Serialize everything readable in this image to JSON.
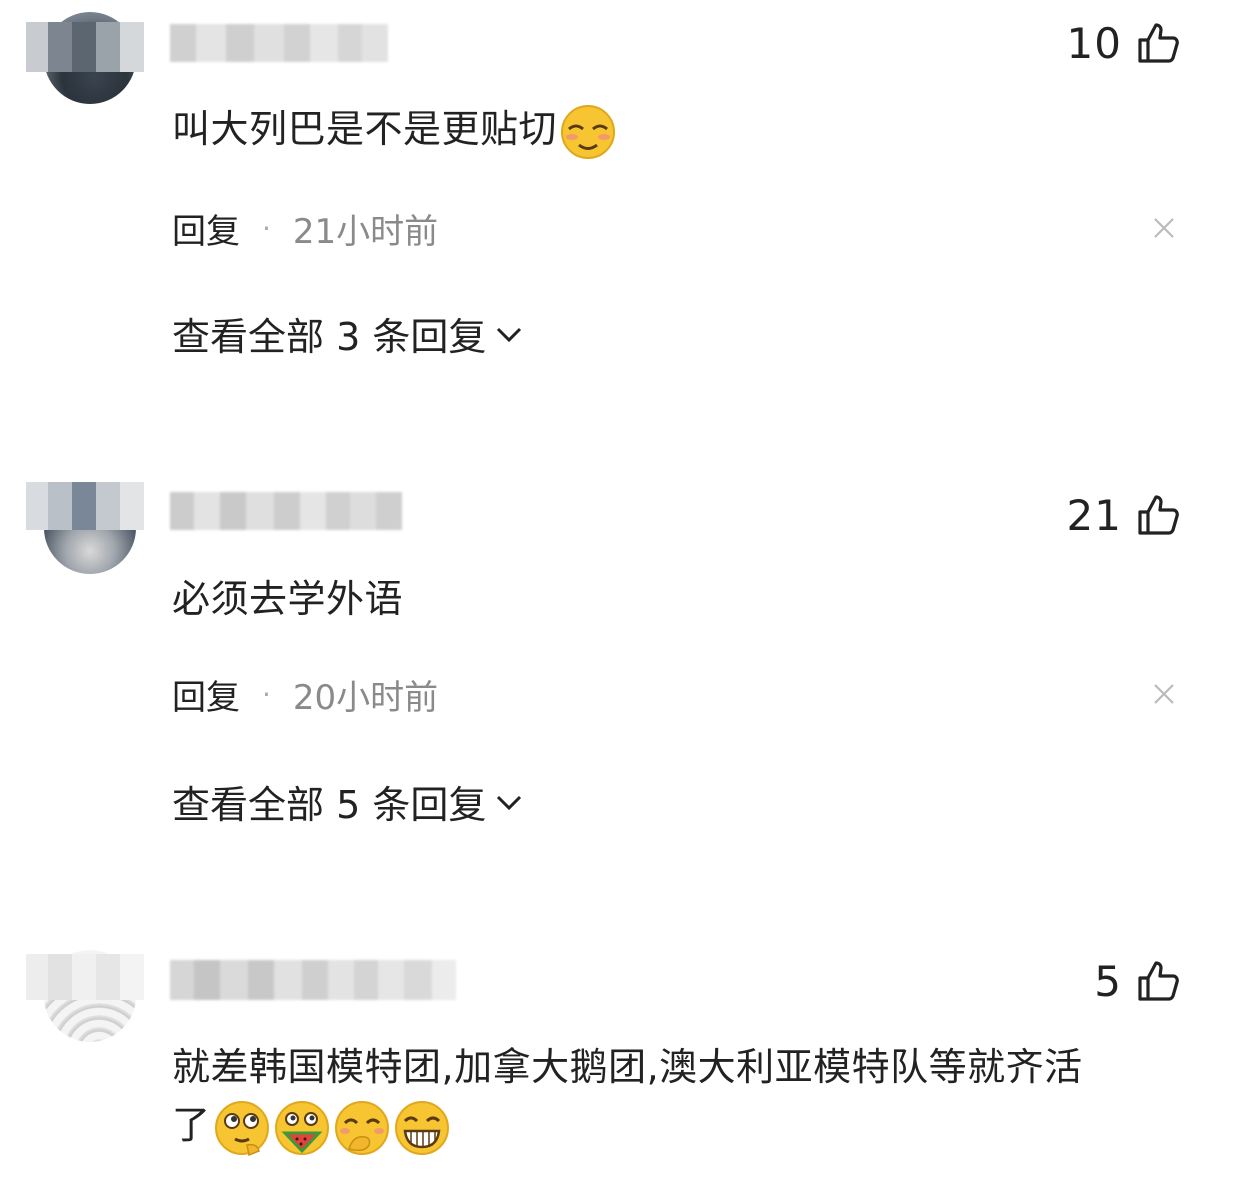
{
  "comments": [
    {
      "likes": "10",
      "text": "叫大列巴是不是更贴切",
      "reply_label": "回复",
      "separator": "·",
      "time": "21小时前",
      "view_all": "查看全部 3 条回复"
    },
    {
      "likes": "21",
      "text": "必须去学外语",
      "reply_label": "回复",
      "separator": "·",
      "time": "20小时前",
      "view_all": "查看全部 5 条回复"
    },
    {
      "likes": "5",
      "text_line1": "就差韩国模特团,加拿大鹅团,澳大利亚模特队等就齐活",
      "text_line2": "了"
    }
  ],
  "icons": {
    "like": "thumbs-up-icon",
    "close": "close-icon",
    "expand": "chevron-down-icon",
    "emoji_smile": "smug-face-emoji",
    "emoji_thinking": "thinking-face-emoji",
    "emoji_melon": "eating-melon-emoji",
    "emoji_giggle": "covering-mouth-emoji",
    "emoji_grin": "grinning-face-emoji"
  },
  "colors": {
    "text": "#222222",
    "secondary": "#8a8a8a",
    "emoji": "#f7c531"
  }
}
